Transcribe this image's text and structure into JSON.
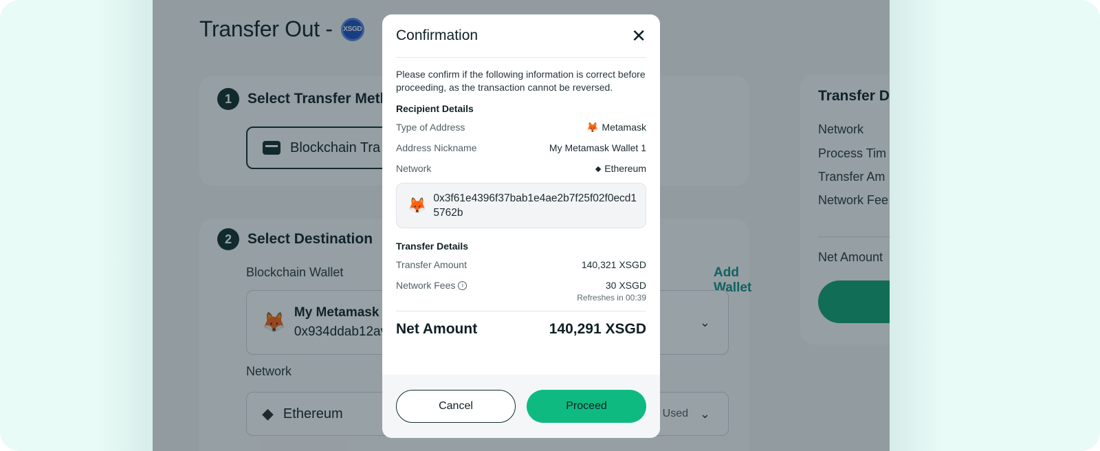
{
  "background": {
    "page_title": "Transfer Out -",
    "token_badge": "XSGD",
    "step1": {
      "number": "1",
      "title": "Select Transfer Meth",
      "method_option": "Blockchain Tra"
    },
    "step2": {
      "number": "2",
      "title": "Select Destination",
      "wallet_label": "Blockchain Wallet",
      "add_wallet": "Add Wallet",
      "wallet_name": "My Metamask W",
      "wallet_address": "0x934ddab12av",
      "network_label": "Network",
      "network_value": "Ethereum",
      "last_used": "t Used"
    },
    "summary": {
      "title": "Transfer D",
      "rows": [
        "Network",
        "Process Tim",
        "Transfer Am",
        "Network Fee"
      ],
      "net_amount_label": "Net Amount"
    }
  },
  "modal": {
    "title": "Confirmation",
    "intro": "Please confirm if the following information is correct before proceeding, as the transaction cannot be reversed.",
    "recipient": {
      "heading": "Recipient Details",
      "rows": [
        {
          "label": "Type of Address",
          "value": "Metamask",
          "icon": "fox-icon"
        },
        {
          "label": "Address Nickname",
          "value": "My Metamask Wallet 1"
        },
        {
          "label": "Network",
          "value": "Ethereum",
          "icon": "ethereum-icon"
        }
      ],
      "address": "0x3f61e4396f37bab1e4ae2b7f25f02f0ecd15762b"
    },
    "transfer": {
      "heading": "Transfer Details",
      "amount_label": "Transfer Amount",
      "amount_value": "140,321 XSGD",
      "fees_label": "Network Fees",
      "fees_value": "30 XSGD",
      "refresh_text": "Refreshes in 00:39",
      "net_label": "Net Amount",
      "net_value": "140,291 XSGD"
    },
    "buttons": {
      "cancel": "Cancel",
      "proceed": "Proceed"
    }
  },
  "colors": {
    "accent_green": "#0fba80",
    "brand_teal": "#0b8f8a",
    "dark": "#0f2b2b"
  }
}
